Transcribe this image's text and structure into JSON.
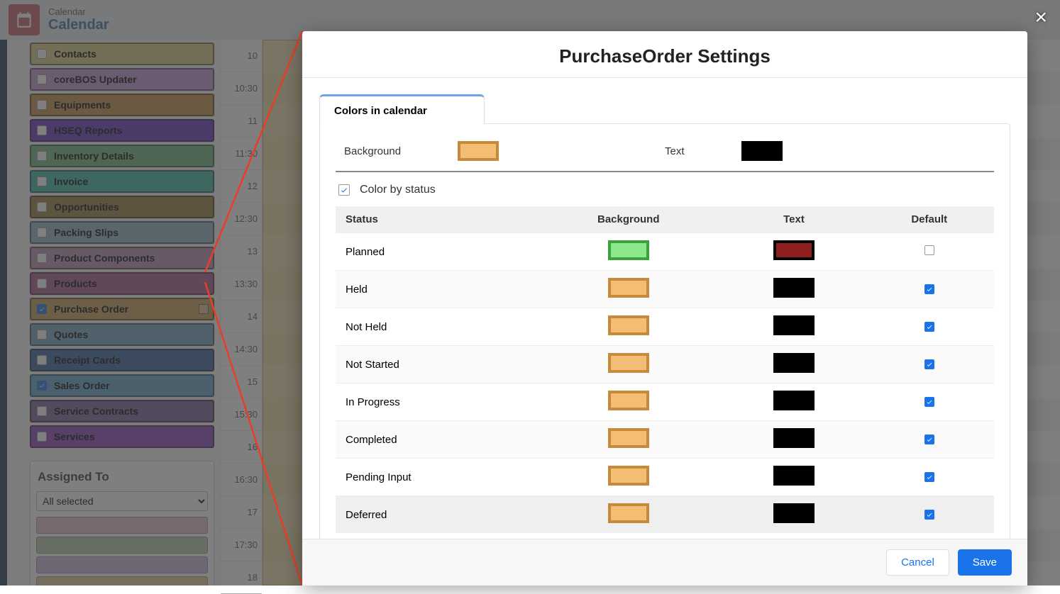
{
  "app": {
    "title_small": "Calendar",
    "title_big": "Calendar"
  },
  "close_label": "×",
  "sidebar": {
    "modules": [
      {
        "label": "Contacts",
        "checked": false,
        "bg": "#d8d07e",
        "show_settings": false
      },
      {
        "label": "coreBOS Updater",
        "checked": false,
        "bg": "#c58fd4",
        "show_settings": false
      },
      {
        "label": "Equipments",
        "checked": false,
        "bg": "#c78a3d",
        "show_settings": false
      },
      {
        "label": "HSEQ Reports",
        "checked": false,
        "bg": "#5e2fc0",
        "show_settings": false
      },
      {
        "label": "Inventory Details",
        "checked": false,
        "bg": "#6eb47a",
        "show_settings": false
      },
      {
        "label": "Invoice",
        "checked": false,
        "bg": "#2fb8a0",
        "show_settings": false
      },
      {
        "label": "Opportunities",
        "checked": false,
        "bg": "#9a7b3a",
        "show_settings": false
      },
      {
        "label": "Packing Slips",
        "checked": false,
        "bg": "#8fb4c8",
        "show_settings": false
      },
      {
        "label": "Product Components",
        "checked": false,
        "bg": "#bc8bb8",
        "show_settings": false
      },
      {
        "label": "Products",
        "checked": false,
        "bg": "#a4528f",
        "show_settings": false
      },
      {
        "label": "Purchase Order",
        "checked": true,
        "bg": "#c99a4f",
        "show_settings": true
      },
      {
        "label": "Quotes",
        "checked": false,
        "bg": "#6fa4c4",
        "show_settings": false
      },
      {
        "label": "Receipt Cards",
        "checked": false,
        "bg": "#2f5fa0",
        "show_settings": false
      },
      {
        "label": "Sales Order",
        "checked": true,
        "bg": "#5aa6cc",
        "show_settings": false
      },
      {
        "label": "Service Contracts",
        "checked": false,
        "bg": "#7a5c9c",
        "show_settings": false
      },
      {
        "label": "Services",
        "checked": false,
        "bg": "#8a3fc0",
        "show_settings": false
      }
    ],
    "assigned": {
      "title": "Assigned To",
      "selected": "All selected",
      "legend_colors": [
        "#e7bcd0",
        "#b7caa6",
        "#d3b5e4",
        "#e6c99a"
      ]
    }
  },
  "times": [
    "10",
    "10:30",
    "11",
    "11:30",
    "12",
    "12:30",
    "13",
    "13:30",
    "14",
    "14:30",
    "15",
    "15:30",
    "16",
    "16:30",
    "17",
    "17:30",
    "18"
  ],
  "modal": {
    "title": "PurchaseOrder Settings",
    "tab_label": "Colors in calendar",
    "bg_label": "Background",
    "text_label": "Text",
    "bg_swatch": {
      "fill": "#f3bd74",
      "border": "#c78a3d"
    },
    "text_swatch": {
      "fill": "#000000",
      "border": "#000000"
    },
    "color_by_status_label": "Color by status",
    "color_by_status_checked": true,
    "headers": {
      "status": "Status",
      "bg": "Background",
      "text": "Text",
      "def": "Default"
    },
    "rows": [
      {
        "status": "Planned",
        "bg": {
          "fill": "#8de88d",
          "border": "#3aa33a"
        },
        "text": {
          "fill": "#8e1f1f",
          "border": "#000"
        },
        "def": false
      },
      {
        "status": "Held",
        "bg": {
          "fill": "#f3bd74",
          "border": "#c78a3d"
        },
        "text": {
          "fill": "#000",
          "border": "#000"
        },
        "def": true
      },
      {
        "status": "Not Held",
        "bg": {
          "fill": "#f3bd74",
          "border": "#c78a3d"
        },
        "text": {
          "fill": "#000",
          "border": "#000"
        },
        "def": true
      },
      {
        "status": "Not Started",
        "bg": {
          "fill": "#f3bd74",
          "border": "#c78a3d"
        },
        "text": {
          "fill": "#000",
          "border": "#000"
        },
        "def": true
      },
      {
        "status": "In Progress",
        "bg": {
          "fill": "#f3bd74",
          "border": "#c78a3d"
        },
        "text": {
          "fill": "#000",
          "border": "#000"
        },
        "def": true
      },
      {
        "status": "Completed",
        "bg": {
          "fill": "#f3bd74",
          "border": "#c78a3d"
        },
        "text": {
          "fill": "#000",
          "border": "#000"
        },
        "def": true
      },
      {
        "status": "Pending Input",
        "bg": {
          "fill": "#f3bd74",
          "border": "#c78a3d"
        },
        "text": {
          "fill": "#000",
          "border": "#000"
        },
        "def": true
      },
      {
        "status": "Deferred",
        "bg": {
          "fill": "#f3bd74",
          "border": "#c78a3d"
        },
        "text": {
          "fill": "#000",
          "border": "#000"
        },
        "def": true
      }
    ],
    "cancel_label": "Cancel",
    "save_label": "Save"
  }
}
